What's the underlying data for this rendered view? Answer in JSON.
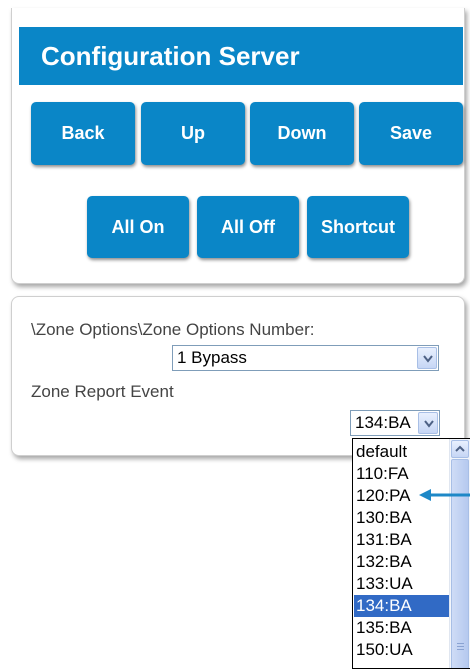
{
  "header": {
    "title": "Configuration Server"
  },
  "toolbar": {
    "back_label": "Back",
    "up_label": "Up",
    "down_label": "Down",
    "save_label": "Save",
    "all_on_label": "All On",
    "all_off_label": "All Off",
    "shortcut_label": "Shortcut"
  },
  "options": {
    "path_label": "\\Zone Options\\Zone Options Number:",
    "zone_number_value": "1 Bypass",
    "report_event_label": "Zone Report Event",
    "report_event_value": "134:BA",
    "report_event_options": [
      "default",
      "110:FA",
      "120:PA",
      "130:BA",
      "131:BA",
      "132:BA",
      "133:UA",
      "134:BA",
      "135:BA",
      "150:UA"
    ],
    "selected_option": "134:BA"
  },
  "colors": {
    "accent": "#0a86c7",
    "selection": "#316ac5",
    "arrow": "#1e88c7"
  }
}
